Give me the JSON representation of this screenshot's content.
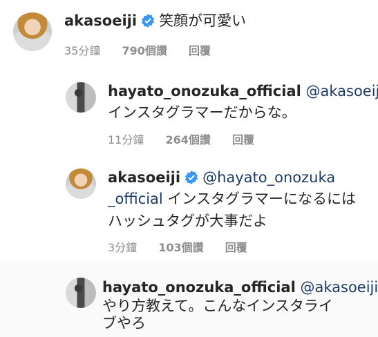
{
  "comments": [
    {
      "username": "akasoeiji",
      "verified": true,
      "mention": "",
      "text": "笑顔が可愛い",
      "time": "35分鐘",
      "likes": "790個讚",
      "reply": "回覆"
    },
    {
      "username": "hayato_onozuka_official",
      "verified": false,
      "mention": "@akasoeiji",
      "text": "インスタグラマーだからな。",
      "time": "11分鐘",
      "likes": "264個讚",
      "reply": "回覆"
    },
    {
      "username": "akasoeiji",
      "verified": true,
      "mention_part1": "@hayato_onozuka",
      "mention_part2": "_official",
      "text_part1": "インスタグラマーになるには",
      "text_part2": "ハッシュタグが大事だよ",
      "time": "3分鐘",
      "likes": "103個讚",
      "reply": "回覆"
    },
    {
      "username": "hayato_onozuka_official",
      "verified": false,
      "mention": "@akasoeiji",
      "text_part1": "やり方教えて。こんなインスタライ",
      "text_part2": "ブやろ"
    }
  ],
  "colors": {
    "username": "#262626",
    "mention": "#1d3a66",
    "meta": "#8e8e8e",
    "verified": "#3897f0"
  },
  "icons": {
    "verified": "verified-badge-icon"
  }
}
